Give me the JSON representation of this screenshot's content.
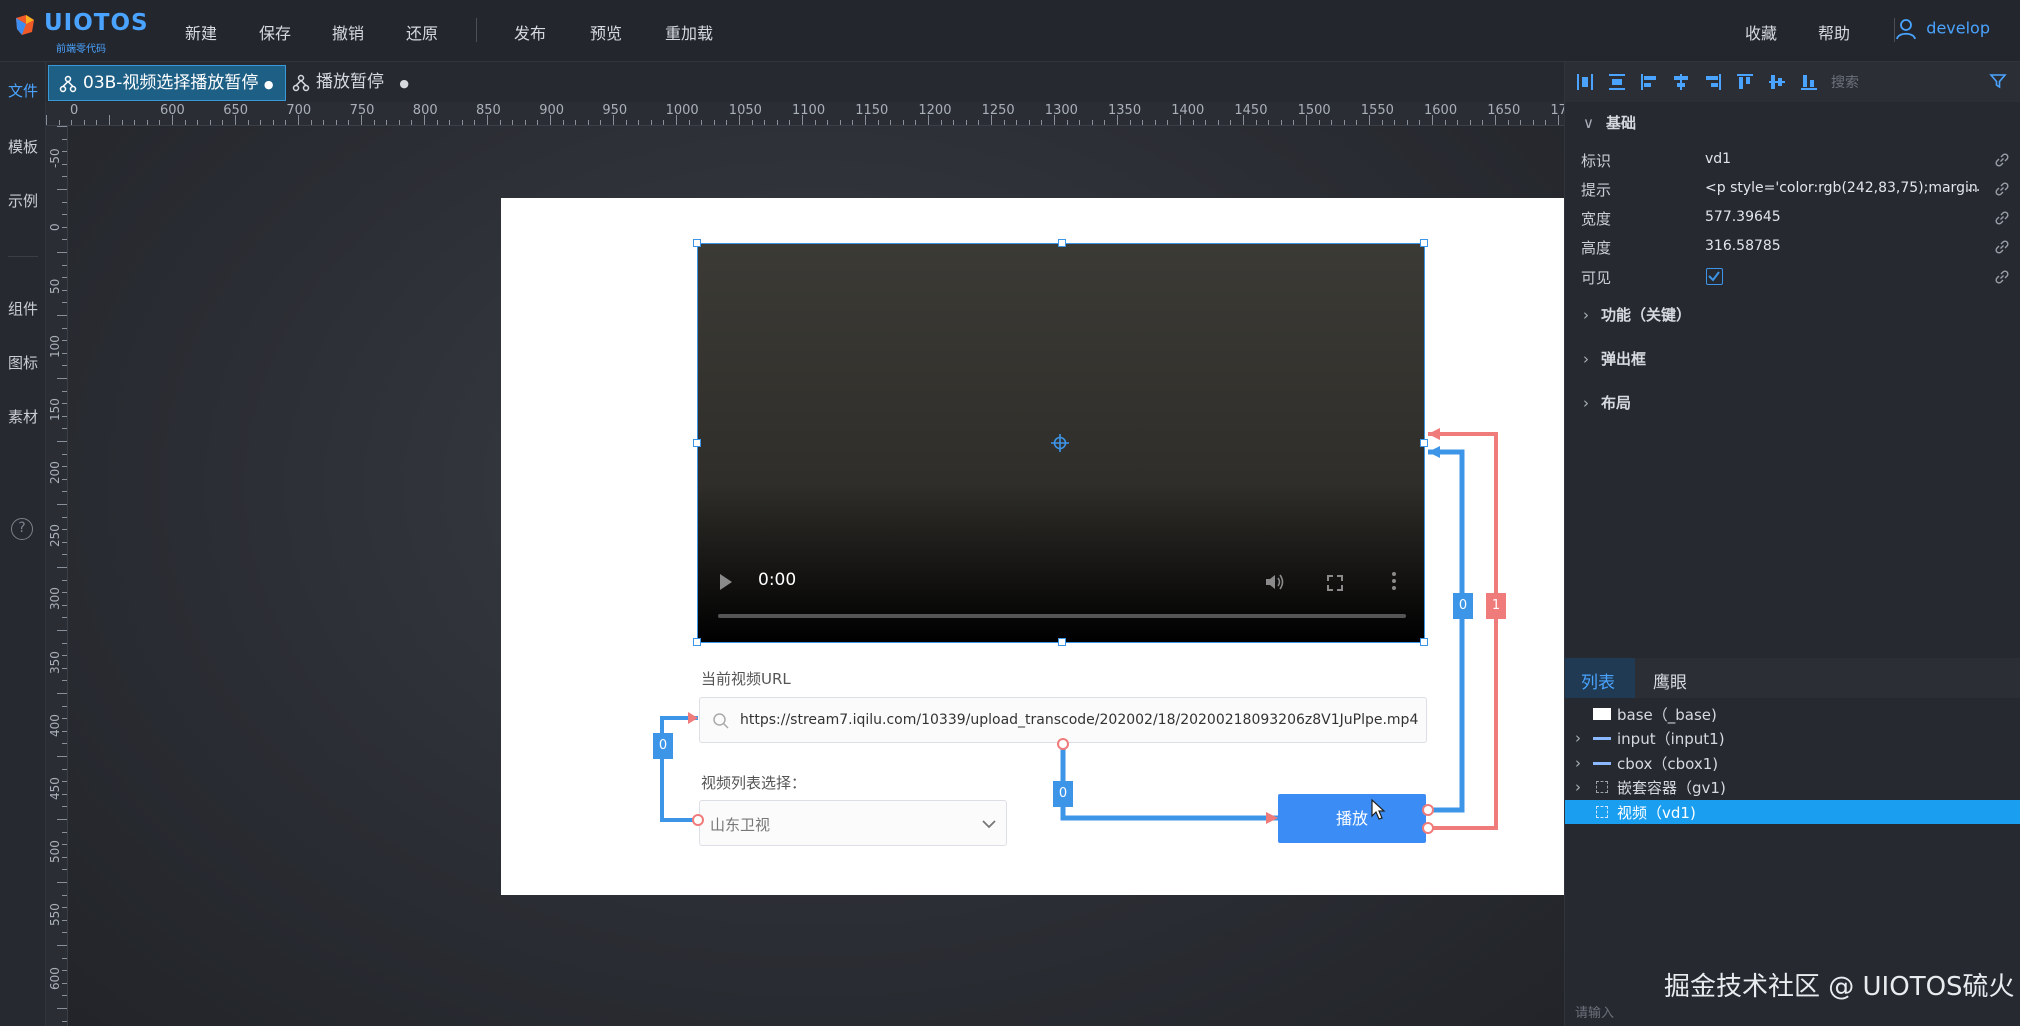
{
  "app": {
    "logo_name": "UIOTOS",
    "logo_sub": "前端零代码"
  },
  "menu": {
    "new": "新建",
    "save": "保存",
    "undo": "撤销",
    "redo": "还原",
    "publish": "发布",
    "preview": "预览",
    "reload": "重加载",
    "favorite": "收藏",
    "help": "帮助",
    "user": "develop"
  },
  "left_toolbar": {
    "items": [
      "文件",
      "模板",
      "示例",
      "组件",
      "图标",
      "素材"
    ],
    "help_icon_glyph": "?"
  },
  "tabs": [
    {
      "label": "03B-视频选择播放暂停",
      "dot": "●"
    },
    {
      "label": "播放暂停",
      "dot": "●"
    }
  ],
  "ruler": {
    "horizontal": [
      "0",
      "600",
      "650",
      "700",
      "750",
      "800",
      "850",
      "900",
      "950",
      "1000",
      "1050",
      "1100",
      "1150",
      "1200",
      "1250",
      "1300",
      "1350",
      "1400",
      "1450",
      "1500",
      "1550",
      "1600",
      "1650",
      "1700"
    ],
    "vertical": [
      "-50",
      "0",
      "50",
      "100",
      "150",
      "200",
      "250",
      "300",
      "350",
      "400",
      "450",
      "500",
      "550",
      "600"
    ]
  },
  "canvas": {
    "video_time": "0:00",
    "url_label": "当前视频URL",
    "url_value": "https://stream7.iqilu.com/10339/upload_transcode/202002/18/20200218093206z8V1JuPlpe.mp4",
    "select_label": "视频列表选择：",
    "select_value": "山东卫视",
    "play_button": "播放",
    "badges": [
      "0",
      "0",
      "0",
      "1"
    ]
  },
  "properties": {
    "search_placeholder": "搜索",
    "section_basic": "基础",
    "rows": [
      {
        "key": "标识",
        "value": "vd1"
      },
      {
        "key": "提示",
        "value": "<p style='color:rgb(242,83,75);margin"
      },
      {
        "key": "宽度",
        "value": "577.39645"
      },
      {
        "key": "高度",
        "value": "316.58785"
      },
      {
        "key": "可见",
        "value": ""
      }
    ],
    "ellipsis": "...",
    "sections": [
      "功能（关键）",
      "弹出框",
      "布局"
    ]
  },
  "list_panel": {
    "tabs": [
      "列表",
      "鹰眼"
    ],
    "items": [
      {
        "label": "base（_base)",
        "expandable": false
      },
      {
        "label": "input（input1)",
        "expandable": true
      },
      {
        "label": "cbox（cbox1)",
        "expandable": true
      },
      {
        "label": "嵌套容器（gv1)",
        "expandable": true
      },
      {
        "label": "视频（vd1)",
        "expandable": false
      }
    ],
    "input_placeholder": "请输入"
  },
  "watermark": "掘金技术社区 @ UIOTOS硫火",
  "colors": {
    "accent": "#4aa3ff",
    "selected_tab": "#1e5f86",
    "tree_selected": "#1a9ef0",
    "play_button": "#3b8cf5",
    "wire_blue": "#3d95e8",
    "wire_red": "#f07b7b"
  }
}
